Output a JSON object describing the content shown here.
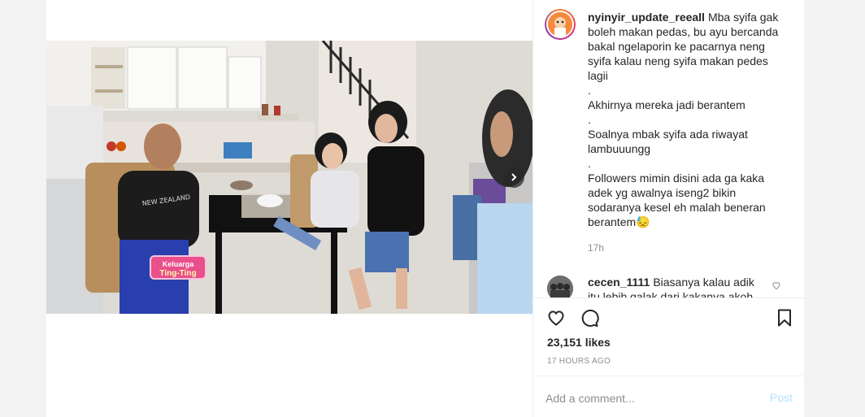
{
  "post": {
    "username": "nyinyir_update_reeall",
    "caption_lines": [
      "Mba syifa gak boleh makan pedas, bu ayu bercanda bakal ngelaporin ke pacarnya neng syifa kalau neng syifa makan pedes lagii",
      ".",
      "Akhirnya mereka jadi berantem",
      ".",
      "Soalnya mbak syifa ada riwayat lambuuungg",
      ".",
      "Followers mimin disini ada ga kaka adek yg awalnya iseng2 bikin sodaranya kesel eh malah beneran berantem😓"
    ],
    "time_ago": "17h",
    "likes": "23,151 likes",
    "posted": "17 HOURS AGO"
  },
  "media": {
    "badge_line1": "Keluarga",
    "badge_line2": "Ting-Ting",
    "shirt_text": "NEW ZEALAND"
  },
  "comment": {
    "username": "cecen_1111",
    "text": "Biasanya kalau adik itu lebih galak dari kakanya akoh"
  },
  "add_comment": {
    "placeholder": "Add a comment...",
    "post_label": "Post"
  },
  "colors": {
    "link_disabled": "#b2dffc",
    "muted": "#8e8e8e",
    "badge": "#e94f8a"
  },
  "icons": [
    "heart-icon",
    "comment-icon",
    "bookmark-icon",
    "chevron-right-icon",
    "small-heart-icon"
  ]
}
